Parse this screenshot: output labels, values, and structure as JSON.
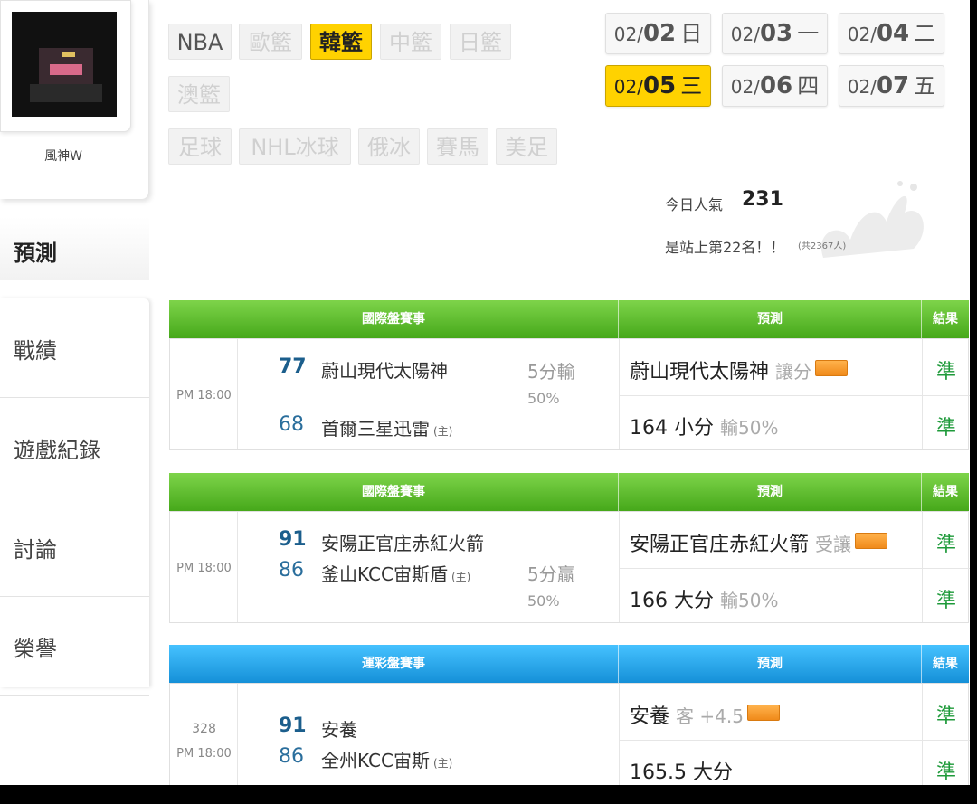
{
  "profile": {
    "username": "風神W"
  },
  "sidebar": {
    "title": "預測",
    "items": [
      {
        "label": "戰績"
      },
      {
        "label": "遊戲紀錄"
      },
      {
        "label": "討論"
      },
      {
        "label": "榮譽"
      }
    ]
  },
  "leagues": [
    "NBA",
    "歐籃",
    "韓籃",
    "中籃",
    "日籃",
    "澳籃",
    "足球",
    "NHL冰球",
    "俄冰",
    "賽馬",
    "美足"
  ],
  "active_league": "韓籃",
  "dates": [
    {
      "month": "02/",
      "day": "02",
      "weekday": "日"
    },
    {
      "month": "02/",
      "day": "03",
      "weekday": "一"
    },
    {
      "month": "02/",
      "day": "04",
      "weekday": "二"
    },
    {
      "month": "02/",
      "day": "05",
      "weekday": "三"
    },
    {
      "month": "02/",
      "day": "06",
      "weekday": "四"
    },
    {
      "month": "02/",
      "day": "07",
      "weekday": "五"
    }
  ],
  "active_date": "05",
  "stats": {
    "popularity_label": "今日人氣",
    "popularity_count": "231",
    "rank_text": "是站上第22名！！",
    "rank_total": "(共2367人)"
  },
  "tables": [
    {
      "type_label": "國際盤賽事",
      "pred_label": "預測",
      "result_label": "結果",
      "time": "PM 18:00",
      "game_no": "",
      "away": {
        "score": "77",
        "name": "蔚山現代太陽神"
      },
      "home": {
        "score": "68",
        "name": "首爾三星迅雷",
        "tag": "(主)"
      },
      "spread": {
        "text": "5分輸",
        "pct": "50%"
      },
      "pred1": {
        "main": "蔚山現代太陽神",
        "sub": "讓分"
      },
      "pred2": {
        "main": "164 小分",
        "sub": "輸50%"
      },
      "result1": "準",
      "result2": "準"
    },
    {
      "type_label": "國際盤賽事",
      "pred_label": "預測",
      "result_label": "結果",
      "time": "PM 18:00",
      "game_no": "",
      "away": {
        "score": "91",
        "name": "安陽正官庄赤紅火箭"
      },
      "home": {
        "score": "86",
        "name": "釜山KCC宙斯盾",
        "tag": "(主)"
      },
      "spread": {
        "text": "5分贏",
        "pct": "50%"
      },
      "pred1": {
        "main": "安陽正官庄赤紅火箭",
        "sub": "受讓"
      },
      "pred2": {
        "main": "166 大分",
        "sub": "輸50%"
      },
      "result1": "準",
      "result2": "準"
    },
    {
      "type_label": "運彩盤賽事",
      "pred_label": "預測",
      "result_label": "結果",
      "time": "PM 18:00",
      "game_no": "328",
      "away": {
        "score": "91",
        "name": "安養"
      },
      "home": {
        "score": "86",
        "name": "全州KCC宙斯",
        "tag": "(主)"
      },
      "spread": {
        "text": "",
        "pct": ""
      },
      "pred1": {
        "main": "安養",
        "sub": "客 +4.5"
      },
      "pred2": {
        "main": "165.5 大分",
        "sub": ""
      },
      "result1": "準",
      "result2": "準"
    }
  ],
  "colors": {
    "active": "#ffd200",
    "header_green": "#46a81a",
    "header_blue": "#1590d8",
    "hit": "#1e9a3a",
    "score": "#1b5e8c"
  }
}
